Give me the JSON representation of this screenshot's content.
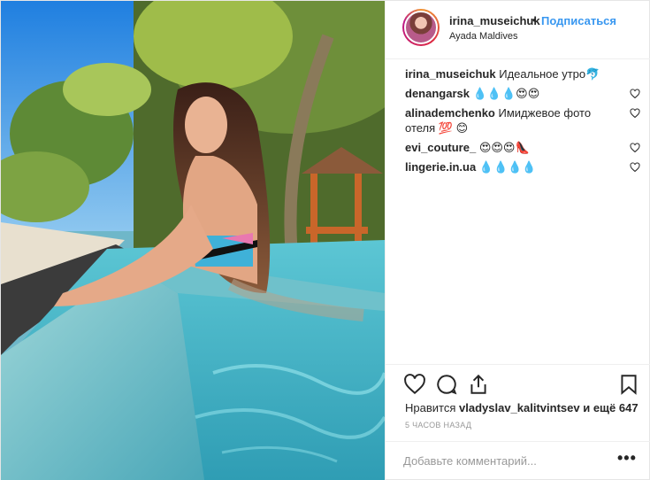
{
  "post": {
    "author": {
      "username": "irina_museichuk",
      "separator": "•",
      "follow_label": "Подписаться",
      "location": "Ayada Maldives"
    },
    "caption": {
      "username": "irina_museichuk",
      "text": "Идеальное утро🐬"
    },
    "comments": [
      {
        "username": "denangarsk",
        "text": "💧💧💧😍😍"
      },
      {
        "username": "alinademchenko",
        "text": "Имиджевое фото отеля 💯 😊"
      },
      {
        "username": "evi_couture_",
        "text": "😍😍😍👠"
      },
      {
        "username": "lingerie.in.ua",
        "text": "💧💧💧💧"
      }
    ],
    "likes": {
      "prefix": "Нравится",
      "user": "vladyslav_kalitvintsev",
      "suffix": "и ещё 647"
    },
    "timestamp": "5 часов назад",
    "add_comment_placeholder": "Добавьте комментарий...",
    "more_label": "•••",
    "icons": {
      "like": "heart-icon",
      "comment": "comment-icon",
      "share": "share-icon",
      "save": "bookmark-icon",
      "comment_like": "heart-outline-icon"
    },
    "colors": {
      "follow": "#3897f0",
      "pool": "#46b2c4",
      "sky": "#2d8de0"
    }
  }
}
